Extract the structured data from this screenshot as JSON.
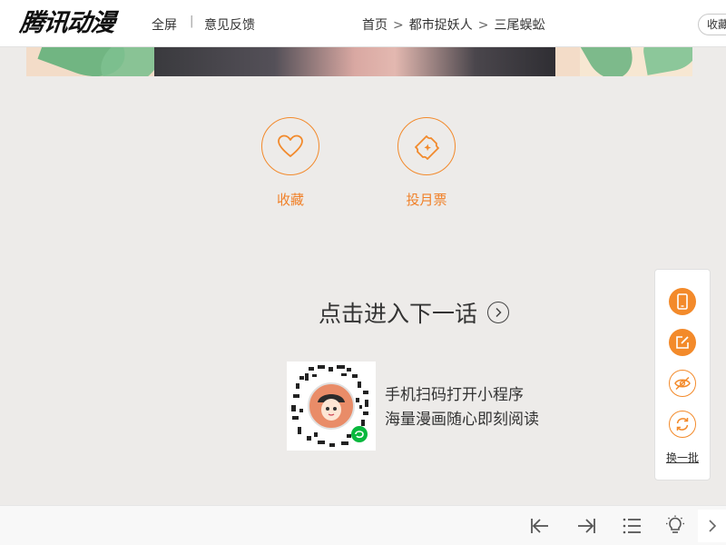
{
  "header": {
    "logo_text": "腾讯动漫",
    "fullscreen_label": "全屏",
    "separator": "|",
    "feedback_label": "意见反馈",
    "breadcrumb": {
      "home": "首页",
      "comic": "都市捉妖人",
      "chapter": "三尾蜈蚣",
      "separator": ">"
    },
    "favorite_pill": "收藏"
  },
  "actions": {
    "favorite_label": "收藏",
    "monthly_ticket_label": "投月票"
  },
  "next_chapter": {
    "label": "点击进入下一话"
  },
  "qr_promo": {
    "line1": "手机扫码打开小程序",
    "line2": "海量漫画随心即刻阅读"
  },
  "float_panel": {
    "buttons": [
      "phone-icon",
      "edit-icon",
      "eye-off-icon",
      "refresh-icon"
    ],
    "more_label": "换一批"
  },
  "toolbar": {
    "icons": [
      "first-page-icon",
      "last-page-icon",
      "list-icon",
      "lightbulb-icon",
      "chevron-right-icon"
    ]
  },
  "colors": {
    "accent": "#f28a2c",
    "background": "#edebe9"
  }
}
